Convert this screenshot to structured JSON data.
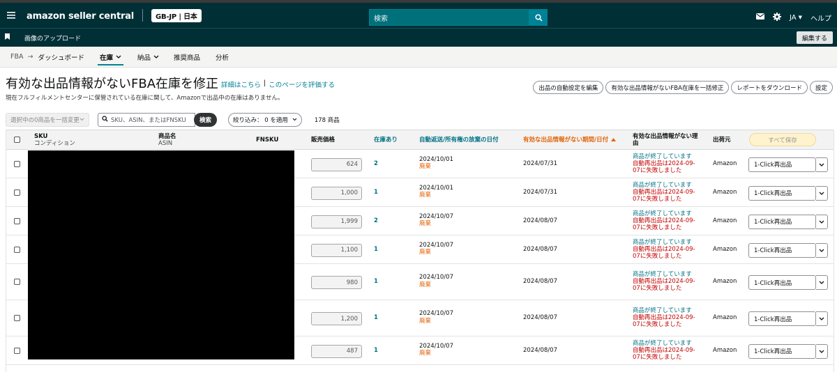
{
  "topbar": {
    "brand": "amazon seller central",
    "marketplace": "GB-JP | 日本",
    "search_placeholder": "検索",
    "language": "JA",
    "help": "ヘルプ"
  },
  "subbar": {
    "bookmark_label": "画像のアップロード",
    "edit_label": "編集する"
  },
  "nav": {
    "fba": "FBA",
    "arrow": "→",
    "items": [
      "ダッシュボード",
      "在庫",
      "納品",
      "推奨商品",
      "分析"
    ]
  },
  "header": {
    "title": "有効な出品情報がないFBA在庫を修正",
    "link_details": "詳細はこちら",
    "link_rate": "このページを評価する",
    "subtitle": "現在フルフィルメントセンターに保管されている在庫に関して、Amazonで出品中の在庫はありません。",
    "buttons": [
      "出品の自動設定を編集",
      "有効な出品情報がないFBA在庫を一括修正",
      "レポートをダウンロード",
      "設定"
    ]
  },
  "filters": {
    "bulk_change": "選択中の0商品を一括変更",
    "search_placeholder": "SKU、ASIN、またはFNSKU",
    "search_button": "検索",
    "narrow": "絞り込み： 0 を適用",
    "count": "178 商品"
  },
  "table": {
    "headers": {
      "sku": "SKU",
      "sku_sub": "コンディション",
      "name": "商品名",
      "name_sub": "ASIN",
      "fnsku": "FNSKU",
      "price": "販売価格",
      "stock": "在庫あり",
      "auto_date": "自動返送/所有権の放棄の日付",
      "inactive_date": "有効な出品情報がない期間/日付",
      "reason": "有効な出品情報がない理由",
      "ship_from": "出荷元",
      "save_all": "すべて保存"
    },
    "rows": [
      {
        "price": "624",
        "stock": "2",
        "auto_date": "2024/10/01",
        "auto_action": "廃棄",
        "inactive": "2024/07/31",
        "reason_a": "商品が終了しています",
        "reason_b": "自動再出品は2024-09-07に失敗しました",
        "ship": "Amazon",
        "action": "1-Click再出品"
      },
      {
        "price": "1,000",
        "stock": "1",
        "auto_date": "2024/10/01",
        "auto_action": "廃棄",
        "inactive": "2024/07/31",
        "reason_a": "商品が終了しています",
        "reason_b": "自動再出品は2024-09-07に失敗しました",
        "ship": "Amazon",
        "action": "1-Click再出品"
      },
      {
        "price": "1,999",
        "stock": "2",
        "auto_date": "2024/10/07",
        "auto_action": "廃棄",
        "inactive": "2024/08/07",
        "reason_a": "商品が終了しています",
        "reason_b": "自動再出品は2024-09-07に失敗しました",
        "ship": "Amazon",
        "action": "1-Click再出品"
      },
      {
        "price": "1,100",
        "stock": "1",
        "auto_date": "2024/10/07",
        "auto_action": "廃棄",
        "inactive": "2024/08/07",
        "reason_a": "商品が終了しています",
        "reason_b": "自動再出品は2024-09-07に失敗しました",
        "ship": "Amazon",
        "action": "1-Click再出品"
      },
      {
        "price": "980",
        "stock": "1",
        "auto_date": "2024/10/07",
        "auto_action": "廃棄",
        "inactive": "2024/08/07",
        "reason_a": "商品が終了しています",
        "reason_b": "自動再出品は2024-09-07に失敗しました",
        "ship": "Amazon",
        "action": "1-Click再出品"
      },
      {
        "price": "1,200",
        "stock": "1",
        "auto_date": "2024/10/07",
        "auto_action": "廃棄",
        "inactive": "2024/08/07",
        "reason_a": "商品が終了しています",
        "reason_b": "自動再出品は2024-09-07に失敗しました",
        "ship": "Amazon",
        "action": "1-Click再出品"
      },
      {
        "price": "487",
        "stock": "1",
        "auto_date": "2024/10/07",
        "auto_action": "廃棄",
        "inactive": "2024/08/07",
        "reason_a": "商品が終了しています",
        "reason_b": "自動再出品は2024-09-07に失敗しました",
        "ship": "Amazon",
        "action": "1-Click再出品"
      }
    ]
  },
  "colors": {
    "topbar": "#002f36",
    "link": "#007185",
    "sorted": "#e3650a",
    "error": "#c40000"
  }
}
